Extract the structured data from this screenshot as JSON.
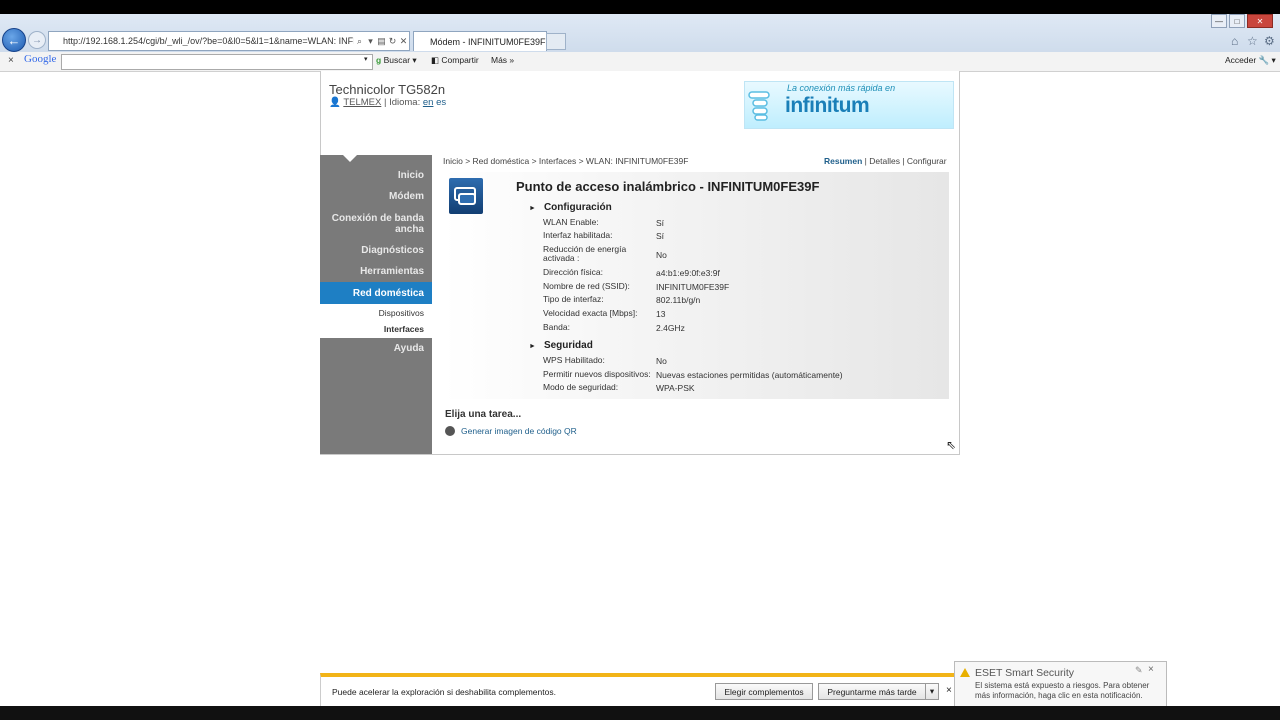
{
  "browser": {
    "address": "http://192.168.1.254/cgi/b/_wli_/ov/?be=0&l0=5&l1=1&name=WLAN: INFINITUM",
    "tab_title": "Módem - INFINITUM0FE39F",
    "tab_close": "×"
  },
  "google_bar": {
    "close": "×",
    "logo": "Google",
    "buscar": "Buscar",
    "compartir": "Compartir",
    "mas": "Más »",
    "acceder": "Acceder"
  },
  "header": {
    "model": "Technicolor TG582n",
    "user": "TELMEX",
    "idioma_label": "Idioma:",
    "lang_en": "en",
    "lang_es": "es",
    "banner_top": "La conexión más rápida en",
    "banner_big": "infinitum"
  },
  "sidebar": {
    "items": [
      {
        "label": "Inicio"
      },
      {
        "label": "Módem"
      },
      {
        "label": "Conexión de banda ancha"
      },
      {
        "label": "Diagnósticos"
      },
      {
        "label": "Herramientas"
      },
      {
        "label": "Red doméstica"
      },
      {
        "label": "Ayuda"
      }
    ],
    "subitems": [
      {
        "label": "Dispositivos"
      },
      {
        "label": "Interfaces"
      }
    ]
  },
  "breadcrumb": "Inicio > Red doméstica > Interfaces > WLAN: INFINITUM0FE39F",
  "views": {
    "resumen": "Resumen",
    "detalles": "Detalles",
    "configurar": "Configurar",
    "sep": "|"
  },
  "panel": {
    "title": "Punto de acceso inalámbrico - INFINITUM0FE39F",
    "config_title": "Configuración",
    "config": [
      {
        "label": "WLAN Enable:",
        "value": "Sí"
      },
      {
        "label": "Interfaz habilitada:",
        "value": "Sí"
      },
      {
        "label": "Reducción de energía activada :",
        "value": "No"
      },
      {
        "label": "Dirección física:",
        "value": "a4:b1:e9:0f:e3:9f"
      },
      {
        "label": "Nombre de red (SSID):",
        "value": "INFINITUM0FE39F"
      },
      {
        "label": "Tipo de interfaz:",
        "value": "802.11b/g/n"
      },
      {
        "label": "Velocidad exacta [Mbps]:",
        "value": "13"
      },
      {
        "label": "Banda:",
        "value": "2.4GHz"
      }
    ],
    "security_title": "Seguridad",
    "security": [
      {
        "label": "WPS Habilitado:",
        "value": "No"
      },
      {
        "label": "Permitir nuevos dispositivos:",
        "value": "Nuevas estaciones permitidas (automáticamente)"
      },
      {
        "label": "Modo de seguridad:",
        "value": "WPA-PSK"
      }
    ]
  },
  "tasks": {
    "title": "Elija una tarea...",
    "qr": "Generar imagen de código QR"
  },
  "notification": {
    "text": "Puede acelerar la exploración si deshabilita complementos.",
    "btn1": "Elegir complementos",
    "btn2": "Preguntarme más tarde",
    "close": "×"
  },
  "eset": {
    "title": "ESET Smart Security",
    "message": "El sistema está expuesto a riesgos. Para obtener más información, haga clic en esta notificación.",
    "close": "×"
  },
  "colors": {
    "active_nav": "#1e7fc4",
    "sidebar": "#7a7a7a",
    "link": "#1f5f8b",
    "notif_border": "#f2b418"
  }
}
